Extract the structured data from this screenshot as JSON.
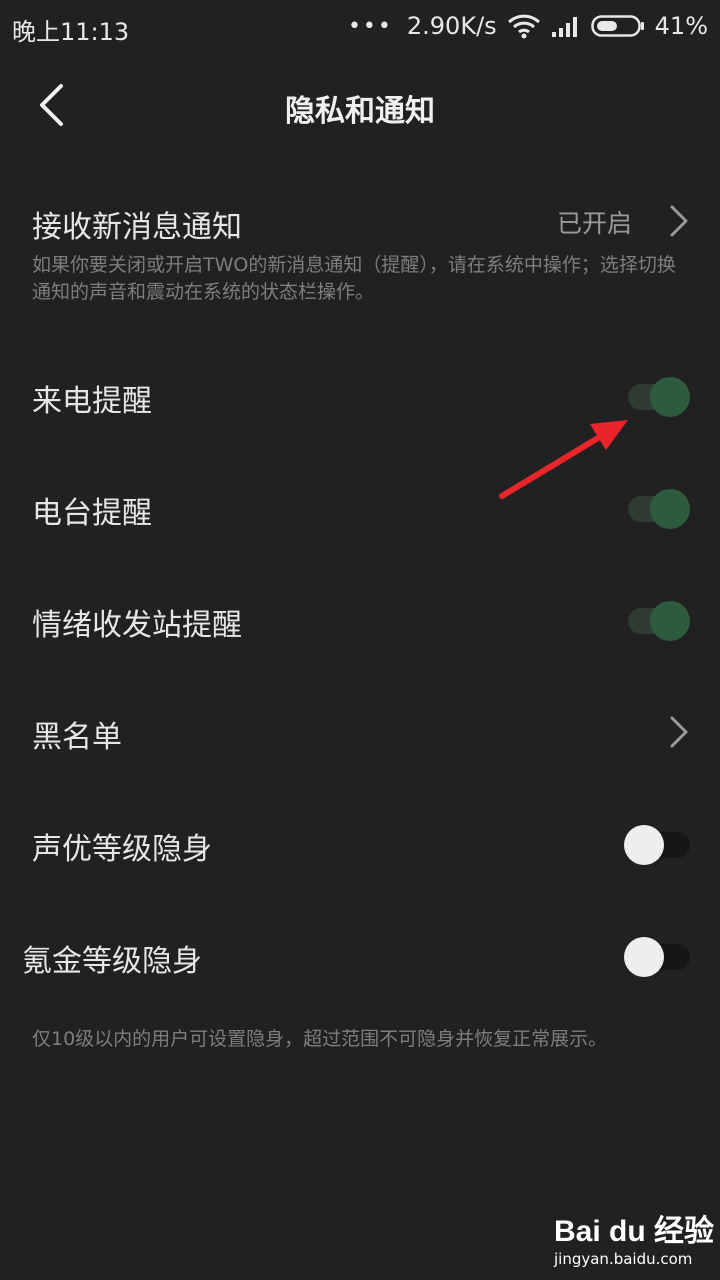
{
  "status_bar": {
    "time": "晚上11:13",
    "dots": "•••",
    "speed": "2.90K/s",
    "battery": "41%"
  },
  "header": {
    "title": "隐私和通知"
  },
  "settings": {
    "new_msg": {
      "label": "接收新消息通知",
      "value": "已开启",
      "desc": "如果你要关闭或开启TWO的新消息通知（提醒），请在系统中操作；选择切换通知的声音和震动在系统的状态栏操作。"
    },
    "call_reminder": {
      "label": "来电提醒",
      "enabled": true
    },
    "radio_reminder": {
      "label": "电台提醒",
      "enabled": true
    },
    "mood_reminder": {
      "label": "情绪收发站提醒",
      "enabled": true
    },
    "blacklist": {
      "label": "黑名单"
    },
    "voice_level_hide": {
      "label": "声优等级隐身",
      "enabled": false
    },
    "krypton_level_hide": {
      "label": "氪金等级隐身",
      "enabled": false
    }
  },
  "footer_note": "仅10级以内的用户可设置隐身，超过范围不可隐身并恢复正常展示。",
  "watermark": {
    "logo": "Bai du 经验",
    "url": "jingyan.baidu.com"
  },
  "colors": {
    "background": "#212121",
    "toggle_on": "#2e5a3d",
    "annotation_arrow": "#e8252a"
  }
}
